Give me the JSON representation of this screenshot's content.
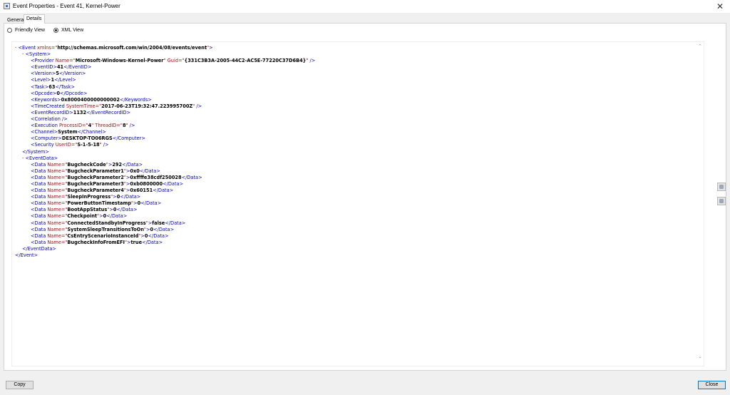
{
  "window": {
    "title": "Event Properties - Event 41, Kernel-Power",
    "close_glyph": "✕"
  },
  "tabs": [
    {
      "label": "General",
      "selected": false
    },
    {
      "label": "Details",
      "selected": true
    }
  ],
  "view_options": {
    "friendly": {
      "label": "Friendly View",
      "selected": false
    },
    "xml": {
      "label": "XML View",
      "selected": true
    }
  },
  "xml_lines": [
    {
      "indent": 0,
      "parts": [
        {
          "c": "minus",
          "t": "- "
        },
        {
          "c": "tag",
          "t": "<Event "
        },
        {
          "c": "attrname",
          "t": "xmlns=\""
        },
        {
          "c": "attrval",
          "t": "http://schemas.microsoft.com/win/2004/08/events/event"
        },
        {
          "c": "attrname",
          "t": "\""
        },
        {
          "c": "tag",
          "t": ">"
        }
      ]
    },
    {
      "indent": 1,
      "parts": [
        {
          "c": "minus",
          "t": "- "
        },
        {
          "c": "tag",
          "t": "<System>"
        }
      ]
    },
    {
      "indent": 2,
      "parts": [
        {
          "c": "tag",
          "t": "<Provider "
        },
        {
          "c": "attrname",
          "t": "Name=\""
        },
        {
          "c": "attrval",
          "t": "Microsoft-Windows-Kernel-Power"
        },
        {
          "c": "attrname",
          "t": "\" Guid=\""
        },
        {
          "c": "attrval",
          "t": "{331C3B3A-2005-44C2-AC5E-77220C37D6B4}"
        },
        {
          "c": "attrname",
          "t": "\""
        },
        {
          "c": "tag",
          "t": " />"
        }
      ]
    },
    {
      "indent": 2,
      "parts": [
        {
          "c": "tag",
          "t": "<EventID>"
        },
        {
          "c": "textval",
          "t": "41"
        },
        {
          "c": "tag",
          "t": "</EventID>"
        }
      ]
    },
    {
      "indent": 2,
      "parts": [
        {
          "c": "tag",
          "t": "<Version>"
        },
        {
          "c": "textval",
          "t": "5"
        },
        {
          "c": "tag",
          "t": "</Version>"
        }
      ]
    },
    {
      "indent": 2,
      "parts": [
        {
          "c": "tag",
          "t": "<Level>"
        },
        {
          "c": "textval",
          "t": "1"
        },
        {
          "c": "tag",
          "t": "</Level>"
        }
      ]
    },
    {
      "indent": 2,
      "parts": [
        {
          "c": "tag",
          "t": "<Task>"
        },
        {
          "c": "textval",
          "t": "63"
        },
        {
          "c": "tag",
          "t": "</Task>"
        }
      ]
    },
    {
      "indent": 2,
      "parts": [
        {
          "c": "tag",
          "t": "<Opcode>"
        },
        {
          "c": "textval",
          "t": "0"
        },
        {
          "c": "tag",
          "t": "</Opcode>"
        }
      ]
    },
    {
      "indent": 2,
      "parts": [
        {
          "c": "tag",
          "t": "<Keywords>"
        },
        {
          "c": "textval",
          "t": "0x8000400000000002"
        },
        {
          "c": "tag",
          "t": "</Keywords>"
        }
      ]
    },
    {
      "indent": 2,
      "parts": [
        {
          "c": "tag",
          "t": "<TimeCreated "
        },
        {
          "c": "attrname",
          "t": "SystemTime=\""
        },
        {
          "c": "attrval",
          "t": "2017-06-23T19:32:47.223995700Z"
        },
        {
          "c": "attrname",
          "t": "\""
        },
        {
          "c": "tag",
          "t": " />"
        }
      ]
    },
    {
      "indent": 2,
      "parts": [
        {
          "c": "tag",
          "t": "<EventRecordID>"
        },
        {
          "c": "textval",
          "t": "1132"
        },
        {
          "c": "tag",
          "t": "</EventRecordID>"
        }
      ]
    },
    {
      "indent": 2,
      "parts": [
        {
          "c": "tag",
          "t": "<Correlation />"
        }
      ]
    },
    {
      "indent": 2,
      "parts": [
        {
          "c": "tag",
          "t": "<Execution "
        },
        {
          "c": "attrname",
          "t": "ProcessID=\""
        },
        {
          "c": "attrval",
          "t": "4"
        },
        {
          "c": "attrname",
          "t": "\" ThreadID=\""
        },
        {
          "c": "attrval",
          "t": "8"
        },
        {
          "c": "attrname",
          "t": "\""
        },
        {
          "c": "tag",
          "t": " />"
        }
      ]
    },
    {
      "indent": 2,
      "parts": [
        {
          "c": "tag",
          "t": "<Channel>"
        },
        {
          "c": "textval",
          "t": "System"
        },
        {
          "c": "tag",
          "t": "</Channel>"
        }
      ]
    },
    {
      "indent": 2,
      "parts": [
        {
          "c": "tag",
          "t": "<Computer>"
        },
        {
          "c": "textval",
          "t": "DESKTOP-TO06RGS"
        },
        {
          "c": "tag",
          "t": "</Computer>"
        }
      ]
    },
    {
      "indent": 2,
      "parts": [
        {
          "c": "tag",
          "t": "<Security "
        },
        {
          "c": "attrname",
          "t": "UserID=\""
        },
        {
          "c": "attrval",
          "t": "S-1-5-18"
        },
        {
          "c": "attrname",
          "t": "\""
        },
        {
          "c": "tag",
          "t": " />"
        }
      ]
    },
    {
      "indent": 1,
      "parts": [
        {
          "c": "tag",
          "t": "</System>"
        }
      ]
    },
    {
      "indent": 1,
      "parts": [
        {
          "c": "minus",
          "t": "- "
        },
        {
          "c": "tag",
          "t": "<EventData>"
        }
      ]
    },
    {
      "indent": 2,
      "parts": [
        {
          "c": "tag",
          "t": "<Data "
        },
        {
          "c": "attrname",
          "t": "Name=\""
        },
        {
          "c": "attrval",
          "t": "BugcheckCode"
        },
        {
          "c": "attrname",
          "t": "\""
        },
        {
          "c": "tag",
          "t": ">"
        },
        {
          "c": "textval",
          "t": "292"
        },
        {
          "c": "tag",
          "t": "</Data>"
        }
      ]
    },
    {
      "indent": 2,
      "parts": [
        {
          "c": "tag",
          "t": "<Data "
        },
        {
          "c": "attrname",
          "t": "Name=\""
        },
        {
          "c": "attrval",
          "t": "BugcheckParameter1"
        },
        {
          "c": "attrname",
          "t": "\""
        },
        {
          "c": "tag",
          "t": ">"
        },
        {
          "c": "textval",
          "t": "0x0"
        },
        {
          "c": "tag",
          "t": "</Data>"
        }
      ]
    },
    {
      "indent": 2,
      "parts": [
        {
          "c": "tag",
          "t": "<Data "
        },
        {
          "c": "attrname",
          "t": "Name=\""
        },
        {
          "c": "attrval",
          "t": "BugcheckParameter2"
        },
        {
          "c": "attrname",
          "t": "\""
        },
        {
          "c": "tag",
          "t": ">"
        },
        {
          "c": "textval",
          "t": "0xffffe38cdf250028"
        },
        {
          "c": "tag",
          "t": "</Data>"
        }
      ]
    },
    {
      "indent": 2,
      "parts": [
        {
          "c": "tag",
          "t": "<Data "
        },
        {
          "c": "attrname",
          "t": "Name=\""
        },
        {
          "c": "attrval",
          "t": "BugcheckParameter3"
        },
        {
          "c": "attrname",
          "t": "\""
        },
        {
          "c": "tag",
          "t": ">"
        },
        {
          "c": "textval",
          "t": "0xb0800000"
        },
        {
          "c": "tag",
          "t": "</Data>"
        }
      ]
    },
    {
      "indent": 2,
      "parts": [
        {
          "c": "tag",
          "t": "<Data "
        },
        {
          "c": "attrname",
          "t": "Name=\""
        },
        {
          "c": "attrval",
          "t": "BugcheckParameter4"
        },
        {
          "c": "attrname",
          "t": "\""
        },
        {
          "c": "tag",
          "t": ">"
        },
        {
          "c": "textval",
          "t": "0x60151"
        },
        {
          "c": "tag",
          "t": "</Data>"
        }
      ]
    },
    {
      "indent": 2,
      "parts": [
        {
          "c": "tag",
          "t": "<Data "
        },
        {
          "c": "attrname",
          "t": "Name=\""
        },
        {
          "c": "attrval",
          "t": "SleepInProgress"
        },
        {
          "c": "attrname",
          "t": "\""
        },
        {
          "c": "tag",
          "t": ">"
        },
        {
          "c": "textval",
          "t": "0"
        },
        {
          "c": "tag",
          "t": "</Data>"
        }
      ]
    },
    {
      "indent": 2,
      "parts": [
        {
          "c": "tag",
          "t": "<Data "
        },
        {
          "c": "attrname",
          "t": "Name=\""
        },
        {
          "c": "attrval",
          "t": "PowerButtonTimestamp"
        },
        {
          "c": "attrname",
          "t": "\""
        },
        {
          "c": "tag",
          "t": ">"
        },
        {
          "c": "textval",
          "t": "0"
        },
        {
          "c": "tag",
          "t": "</Data>"
        }
      ]
    },
    {
      "indent": 2,
      "parts": [
        {
          "c": "tag",
          "t": "<Data "
        },
        {
          "c": "attrname",
          "t": "Name=\""
        },
        {
          "c": "attrval",
          "t": "BootAppStatus"
        },
        {
          "c": "attrname",
          "t": "\""
        },
        {
          "c": "tag",
          "t": ">"
        },
        {
          "c": "textval",
          "t": "0"
        },
        {
          "c": "tag",
          "t": "</Data>"
        }
      ]
    },
    {
      "indent": 2,
      "parts": [
        {
          "c": "tag",
          "t": "<Data "
        },
        {
          "c": "attrname",
          "t": "Name=\""
        },
        {
          "c": "attrval",
          "t": "Checkpoint"
        },
        {
          "c": "attrname",
          "t": "\""
        },
        {
          "c": "tag",
          "t": ">"
        },
        {
          "c": "textval",
          "t": "0"
        },
        {
          "c": "tag",
          "t": "</Data>"
        }
      ]
    },
    {
      "indent": 2,
      "parts": [
        {
          "c": "tag",
          "t": "<Data "
        },
        {
          "c": "attrname",
          "t": "Name=\""
        },
        {
          "c": "attrval",
          "t": "ConnectedStandbyInProgress"
        },
        {
          "c": "attrname",
          "t": "\""
        },
        {
          "c": "tag",
          "t": ">"
        },
        {
          "c": "textval",
          "t": "false"
        },
        {
          "c": "tag",
          "t": "</Data>"
        }
      ]
    },
    {
      "indent": 2,
      "parts": [
        {
          "c": "tag",
          "t": "<Data "
        },
        {
          "c": "attrname",
          "t": "Name=\""
        },
        {
          "c": "attrval",
          "t": "SystemSleepTransitionsToOn"
        },
        {
          "c": "attrname",
          "t": "\""
        },
        {
          "c": "tag",
          "t": ">"
        },
        {
          "c": "textval",
          "t": "0"
        },
        {
          "c": "tag",
          "t": "</Data>"
        }
      ]
    },
    {
      "indent": 2,
      "parts": [
        {
          "c": "tag",
          "t": "<Data "
        },
        {
          "c": "attrname",
          "t": "Name=\""
        },
        {
          "c": "attrval",
          "t": "CsEntryScenarioInstanceId"
        },
        {
          "c": "attrname",
          "t": "\""
        },
        {
          "c": "tag",
          "t": ">"
        },
        {
          "c": "textval",
          "t": "0"
        },
        {
          "c": "tag",
          "t": "</Data>"
        }
      ]
    },
    {
      "indent": 2,
      "parts": [
        {
          "c": "tag",
          "t": "<Data "
        },
        {
          "c": "attrname",
          "t": "Name=\""
        },
        {
          "c": "attrval",
          "t": "BugcheckInfoFromEFI"
        },
        {
          "c": "attrname",
          "t": "\""
        },
        {
          "c": "tag",
          "t": ">"
        },
        {
          "c": "textval",
          "t": "true"
        },
        {
          "c": "tag",
          "t": "</Data>"
        }
      ]
    },
    {
      "indent": 1,
      "parts": [
        {
          "c": "tag",
          "t": "</EventData>"
        }
      ]
    },
    {
      "indent": 0,
      "parts": [
        {
          "c": "tag",
          "t": "</Event>"
        }
      ]
    }
  ],
  "buttons": {
    "copy": "Copy",
    "close": "Close"
  },
  "icons": {
    "scroll_up": "scroll-up-icon",
    "scroll_down": "scroll-down-icon",
    "prev_event": "up-arrow-icon",
    "next_event": "down-arrow-icon"
  },
  "colors": {
    "tag": "#0000c8",
    "minus": "#d00000",
    "attrname": "#a31515",
    "close_focus": "#0078d7"
  }
}
